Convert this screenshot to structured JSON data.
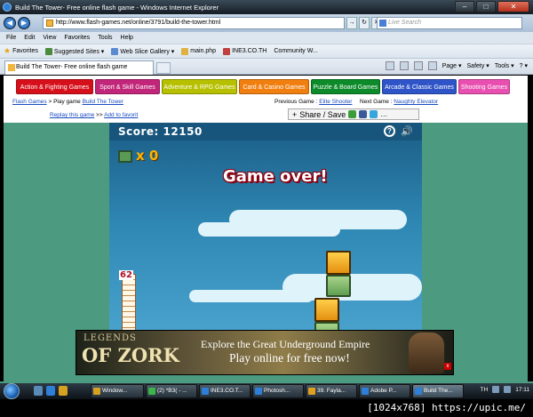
{
  "window": {
    "title": "Build The Tower- Free online flash game - Windows Internet Explorer",
    "min": "–",
    "max": "□",
    "close": "✕"
  },
  "address": {
    "url": "http://www.flash-games.net/online/3791/build-the-tower.html",
    "search_placeholder": "Live Search",
    "back": "◀",
    "forward": "▶",
    "go": "→",
    "refresh": "↻",
    "stop": "✕"
  },
  "menu": [
    "File",
    "Edit",
    "View",
    "Favorites",
    "Tools",
    "Help"
  ],
  "favorites": {
    "label": "Favorites",
    "items": [
      "Suggested Sites ▾",
      "Web Slice Gallery ▾",
      "main.php",
      "INE3.CO.TH",
      "Community  W..."
    ]
  },
  "tab": {
    "title": "Build The Tower- Free online flash game"
  },
  "commands": {
    "page": "Page ▾",
    "safety": "Safety ▾",
    "tools": "Tools ▾",
    "help": "? ▾"
  },
  "categories": [
    {
      "label": "Action & Fighting Games",
      "color": "#d6101a"
    },
    {
      "label": "Sport & Skill Games",
      "color": "#c1267a"
    },
    {
      "label": "Adventure & RPG Games",
      "color": "#b7c000"
    },
    {
      "label": "Card & Casino Games",
      "color": "#f07f10"
    },
    {
      "label": "Puzzle & Board Games",
      "color": "#0d8a2a"
    },
    {
      "label": "Arcade & Classic Games",
      "color": "#2f54c8"
    },
    {
      "label": "Shooting Games",
      "color": "#e84fb0"
    }
  ],
  "breadcrumb": {
    "root": "Flash Games",
    "sep": ">",
    "current_prefix": "Play game",
    "current": "Build The Tower",
    "replay": "Replay this game",
    "sep2": ">>",
    "add_fav": "Add to favorit",
    "prev_label": "Previous Game :",
    "prev_game": "Elite Shooter",
    "next_label": "Next Game :",
    "next_game": "Naughty Elevator"
  },
  "share": {
    "label": "Share / Save"
  },
  "game": {
    "score_label": "Score:",
    "score": "12150",
    "bricks": "x 0",
    "status": "Game over!",
    "height": "62",
    "help": "?",
    "sound": "🔊"
  },
  "ad": {
    "logo_top": "LEGENDS",
    "logo_bottom": "OF ZORK",
    "line1": "Explore the Great Underground Empire",
    "line2": "Play online for free now!"
  },
  "taskbar": {
    "buttons": [
      "Window...",
      "(2) *B3( - ...",
      "INE3.CO.T...",
      "Photosh...",
      "39. Fayla...",
      "Adobe P...",
      "Build The..."
    ],
    "lang": "TH",
    "time": "17:11"
  },
  "caption": "[1024x768] https://upic.me/"
}
